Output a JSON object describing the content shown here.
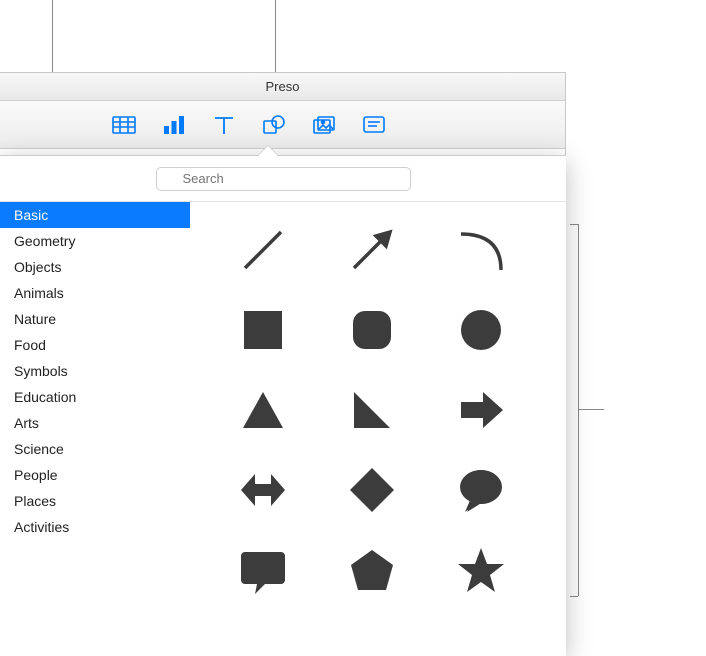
{
  "window": {
    "title": "Preso"
  },
  "toolbar": {
    "icons": [
      "table-icon",
      "chart-icon",
      "text-icon",
      "shape-icon",
      "media-icon",
      "comment-icon"
    ]
  },
  "search": {
    "placeholder": "Search"
  },
  "sidebar": {
    "items": [
      {
        "label": "Basic",
        "selected": true
      },
      {
        "label": "Geometry",
        "selected": false
      },
      {
        "label": "Objects",
        "selected": false
      },
      {
        "label": "Animals",
        "selected": false
      },
      {
        "label": "Nature",
        "selected": false
      },
      {
        "label": "Food",
        "selected": false
      },
      {
        "label": "Symbols",
        "selected": false
      },
      {
        "label": "Education",
        "selected": false
      },
      {
        "label": "Arts",
        "selected": false
      },
      {
        "label": "Science",
        "selected": false
      },
      {
        "label": "People",
        "selected": false
      },
      {
        "label": "Places",
        "selected": false
      },
      {
        "label": "Activities",
        "selected": false
      }
    ]
  },
  "shapes": [
    "line",
    "arrow-line",
    "curve",
    "square",
    "rounded-square",
    "circle",
    "triangle",
    "right-triangle",
    "arrow-right",
    "double-arrow",
    "diamond",
    "speech-bubble",
    "callout-rect",
    "pentagon",
    "star"
  ],
  "colors": {
    "accent": "#007aff",
    "selection": "#0a7bff",
    "shape": "#3c3c3c"
  }
}
